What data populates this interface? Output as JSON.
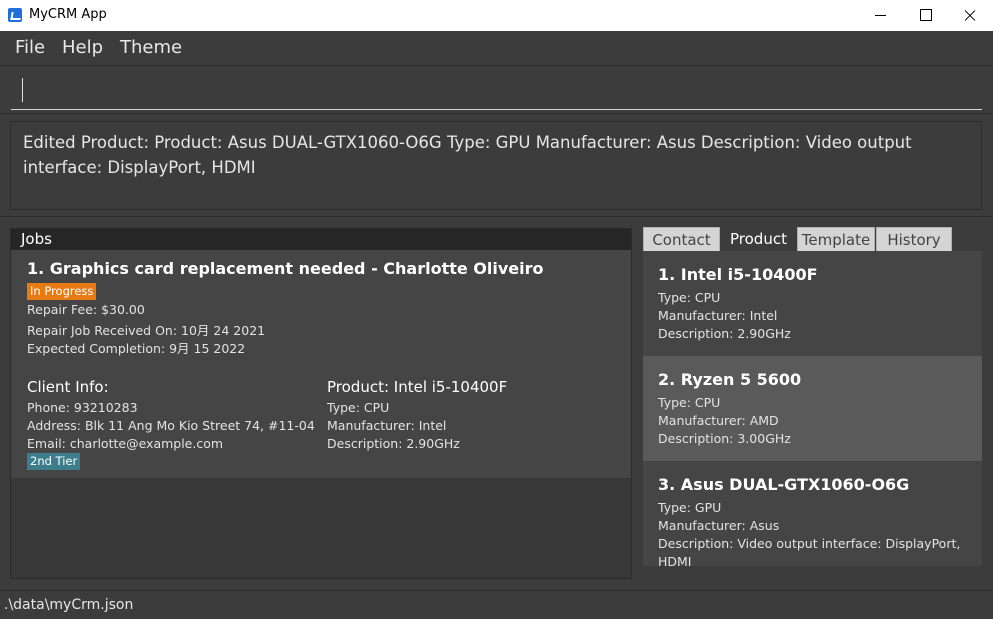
{
  "window": {
    "title": "MyCRM App",
    "icon": "app-logo-icon",
    "controls": [
      "minimize-icon",
      "maximize-icon",
      "close-icon"
    ]
  },
  "menu": {
    "file": "File",
    "help": "Help",
    "theme": "Theme"
  },
  "command": {
    "value": "",
    "placeholder": ""
  },
  "result": {
    "text": "Edited Product: Product: Asus DUAL-GTX1060-O6G Type: GPU Manufacturer: Asus Description: Video output interface: DisplayPort, HDMI"
  },
  "jobs": {
    "header": "Jobs",
    "items": [
      {
        "title": "1. Graphics card replacement needed - Charlotte Oliveiro",
        "status": "In Progress",
        "fee": "Repair Fee: $30.00",
        "received": "Repair Job Received On: 10月 24 2021",
        "expected": "Expected Completion: 9月 15 2022",
        "client_heading": "Client Info:",
        "phone": "Phone: 93210283",
        "address": "Address: Blk 11 Ang Mo Kio Street 74, #11-04",
        "email": "Email: charlotte@example.com",
        "tier": "2nd Tier",
        "product_heading": "Product: Intel i5-10400F",
        "product_type": "Type: CPU",
        "product_manufacturer": "Manufacturer: Intel",
        "product_description": "Description: 2.90GHz"
      }
    ]
  },
  "tabs": {
    "contact": "Contact",
    "product": "Product",
    "template": "Template",
    "history": "History",
    "active": "Product"
  },
  "products": [
    {
      "title": "1.  Intel i5-10400F",
      "type": "Type: CPU",
      "manufacturer": "Manufacturer: Intel",
      "description": "Description: 2.90GHz"
    },
    {
      "title": "2.  Ryzen 5 5600",
      "type": "Type: CPU",
      "manufacturer": "Manufacturer: AMD",
      "description": "Description: 3.00GHz"
    },
    {
      "title": "3.  Asus DUAL-GTX1060-O6G",
      "type": "Type: GPU",
      "manufacturer": "Manufacturer: Asus",
      "description": "Description: Video output interface: DisplayPort,",
      "description_cont": "HDMI"
    }
  ],
  "status_bar": {
    "path": ".\\data\\myCrm.json"
  },
  "colors": {
    "background": "#3c3c3c",
    "status_in_progress": "#e87a14",
    "tier_badge": "#3c7e8c",
    "selected_card": "#5a5a5a"
  }
}
